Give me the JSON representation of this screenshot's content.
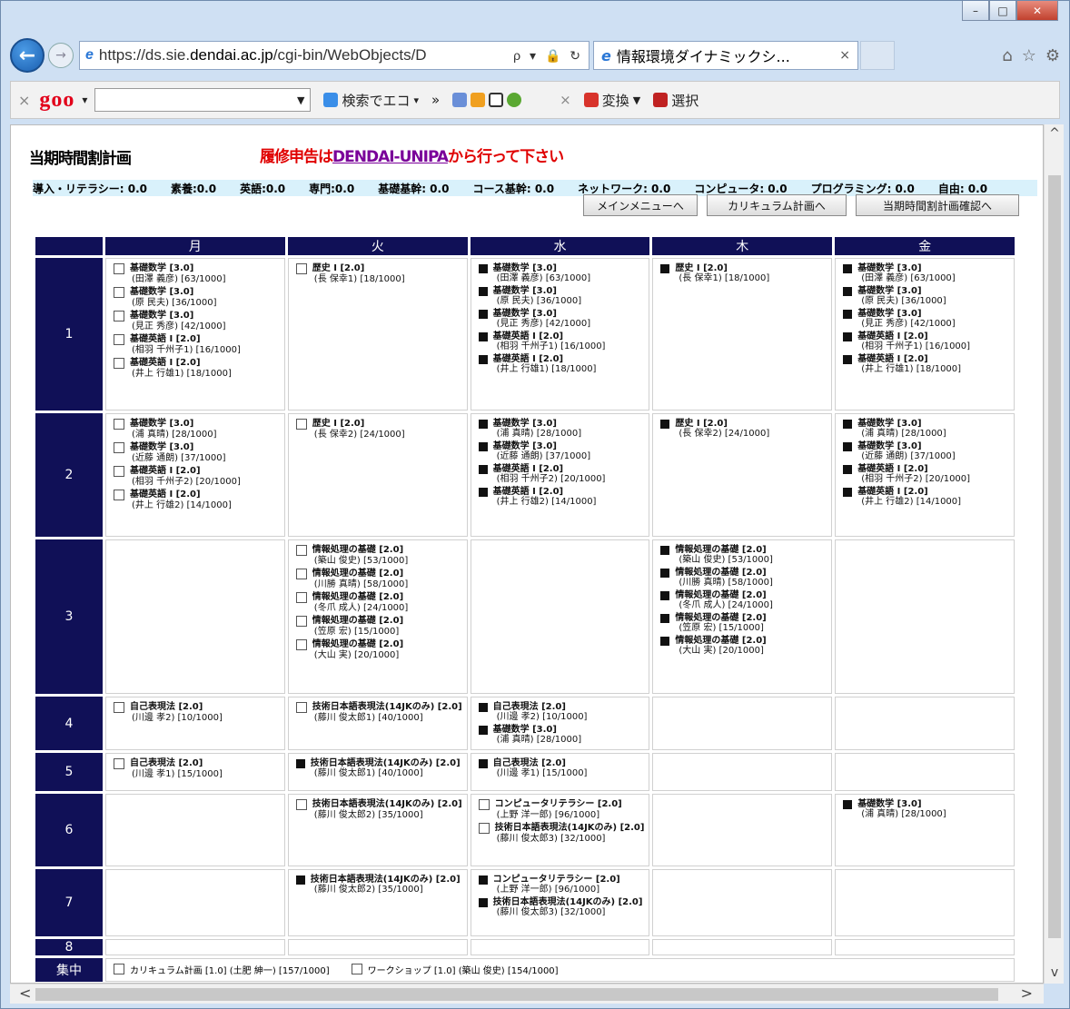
{
  "browser": {
    "url_prefix": "https://ds.sie.",
    "url_host": "dendai.ac.jp",
    "url_rest": "/cgi-bin/WebObjects/D",
    "url_tools": "ρ ▾ 🔒 ↻",
    "tab_title": "情報環境ダイナミックシ...",
    "tab_close": "×",
    "win_min": "–",
    "win_max": "□",
    "win_close": "✕",
    "back": "←",
    "forward": "→",
    "nav_icons": [
      "⌂",
      "☆",
      "⚙"
    ]
  },
  "goo_toolbar": {
    "close": "×",
    "logo": "goo",
    "dropdown": "▾",
    "search_input_value": "",
    "search_label": "検索でエコ",
    "more": "»",
    "right_close": "×",
    "convert_label": "変換",
    "select_label": "選択"
  },
  "page": {
    "title": "当期時間割計画",
    "notice_prefix": "履修申告は",
    "notice_link": "DENDAI-UNIPA",
    "notice_suffix": "から行って下さい",
    "credits": [
      "導入・リテラシー: 0.0",
      "素養:0.0",
      "英語:0.0",
      "専門:0.0",
      "基礎基幹: 0.0",
      "コース基幹: 0.0",
      "ネットワーク: 0.0",
      "コンピュータ: 0.0",
      "プログラミング: 0.0",
      "自由: 0.0"
    ],
    "buttons": {
      "main_menu": "メインメニューへ",
      "curriculum": "カリキュラム計画へ",
      "confirm": "当期時間割計画確認へ"
    }
  },
  "timetable": {
    "days": [
      "月",
      "火",
      "水",
      "木",
      "金"
    ],
    "periods": [
      {
        "label": "1",
        "cells": [
          [
            {
              "checked": false,
              "name": "基礎数学 [3.0]",
              "detail": "(田澤 義彦) [63/1000]"
            },
            {
              "checked": false,
              "name": "基礎数学 [3.0]",
              "detail": "(原 民夫) [36/1000]"
            },
            {
              "checked": false,
              "name": "基礎数学 [3.0]",
              "detail": "(見正 秀彦) [42/1000]"
            },
            {
              "checked": false,
              "name": "基礎英語 I [2.0]",
              "detail": "(相羽 千州子1) [16/1000]"
            },
            {
              "checked": false,
              "name": "基礎英語 I [2.0]",
              "detail": "(井上 行雄1) [18/1000]"
            }
          ],
          [
            {
              "checked": false,
              "name": "歴史 I [2.0]",
              "detail": "(長 保幸1) [18/1000]"
            }
          ],
          [
            {
              "checked": true,
              "name": "基礎数学 [3.0]",
              "detail": "(田澤 義彦) [63/1000]"
            },
            {
              "checked": true,
              "name": "基礎数学 [3.0]",
              "detail": "(原 民夫) [36/1000]"
            },
            {
              "checked": true,
              "name": "基礎数学 [3.0]",
              "detail": "(見正 秀彦) [42/1000]"
            },
            {
              "checked": true,
              "name": "基礎英語 I [2.0]",
              "detail": "(相羽 千州子1) [16/1000]"
            },
            {
              "checked": true,
              "name": "基礎英語 I [2.0]",
              "detail": "(井上 行雄1) [18/1000]"
            }
          ],
          [
            {
              "checked": true,
              "name": "歴史 I [2.0]",
              "detail": "(長 保幸1) [18/1000]"
            }
          ],
          [
            {
              "checked": true,
              "name": "基礎数学 [3.0]",
              "detail": "(田澤 義彦) [63/1000]"
            },
            {
              "checked": true,
              "name": "基礎数学 [3.0]",
              "detail": "(原 民夫) [36/1000]"
            },
            {
              "checked": true,
              "name": "基礎数学 [3.0]",
              "detail": "(見正 秀彦) [42/1000]"
            },
            {
              "checked": true,
              "name": "基礎英語 I [2.0]",
              "detail": "(相羽 千州子1) [16/1000]"
            },
            {
              "checked": true,
              "name": "基礎英語 I [2.0]",
              "detail": "(井上 行雄1) [18/1000]"
            }
          ]
        ]
      },
      {
        "label": "2",
        "cells": [
          [
            {
              "checked": false,
              "name": "基礎数学 [3.0]",
              "detail": "(浦 真晴) [28/1000]"
            },
            {
              "checked": false,
              "name": "基礎数学 [3.0]",
              "detail": "(近藤 通朗) [37/1000]"
            },
            {
              "checked": false,
              "name": "基礎英語 I [2.0]",
              "detail": "(相羽 千州子2) [20/1000]"
            },
            {
              "checked": false,
              "name": "基礎英語 I [2.0]",
              "detail": "(井上 行雄2) [14/1000]"
            }
          ],
          [
            {
              "checked": false,
              "name": "歴史 I [2.0]",
              "detail": "(長 保幸2) [24/1000]"
            }
          ],
          [
            {
              "checked": true,
              "name": "基礎数学 [3.0]",
              "detail": "(浦 真晴) [28/1000]"
            },
            {
              "checked": true,
              "name": "基礎数学 [3.0]",
              "detail": "(近藤 通朗) [37/1000]"
            },
            {
              "checked": true,
              "name": "基礎英語 I [2.0]",
              "detail": "(相羽 千州子2) [20/1000]"
            },
            {
              "checked": true,
              "name": "基礎英語 I [2.0]",
              "detail": "(井上 行雄2) [14/1000]"
            }
          ],
          [
            {
              "checked": true,
              "name": "歴史 I [2.0]",
              "detail": "(長 保幸2) [24/1000]"
            }
          ],
          [
            {
              "checked": true,
              "name": "基礎数学 [3.0]",
              "detail": "(浦 真晴) [28/1000]"
            },
            {
              "checked": true,
              "name": "基礎数学 [3.0]",
              "detail": "(近藤 通朗) [37/1000]"
            },
            {
              "checked": true,
              "name": "基礎英語 I [2.0]",
              "detail": "(相羽 千州子2) [20/1000]"
            },
            {
              "checked": true,
              "name": "基礎英語 I [2.0]",
              "detail": "(井上 行雄2) [14/1000]"
            }
          ]
        ]
      },
      {
        "label": "3",
        "cells": [
          [],
          [
            {
              "checked": false,
              "name": "情報処理の基礎 [2.0]",
              "detail": "(築山 俊史) [53/1000]"
            },
            {
              "checked": false,
              "name": "情報処理の基礎 [2.0]",
              "detail": "(川勝 真晴) [58/1000]"
            },
            {
              "checked": false,
              "name": "情報処理の基礎 [2.0]",
              "detail": "(冬爪 成人) [24/1000]"
            },
            {
              "checked": false,
              "name": "情報処理の基礎 [2.0]",
              "detail": "(笠原 宏) [15/1000]"
            },
            {
              "checked": false,
              "name": "情報処理の基礎 [2.0]",
              "detail": "(大山 実) [20/1000]"
            }
          ],
          [],
          [
            {
              "checked": true,
              "name": "情報処理の基礎 [2.0]",
              "detail": "(築山 俊史) [53/1000]"
            },
            {
              "checked": true,
              "name": "情報処理の基礎 [2.0]",
              "detail": "(川勝 真晴) [58/1000]"
            },
            {
              "checked": true,
              "name": "情報処理の基礎 [2.0]",
              "detail": "(冬爪 成人) [24/1000]"
            },
            {
              "checked": true,
              "name": "情報処理の基礎 [2.0]",
              "detail": "(笠原 宏) [15/1000]"
            },
            {
              "checked": true,
              "name": "情報処理の基礎 [2.0]",
              "detail": "(大山 実) [20/1000]"
            }
          ],
          []
        ]
      },
      {
        "label": "4",
        "cells": [
          [
            {
              "checked": false,
              "name": "自己表現法 [2.0]",
              "detail": "(川邊 孝2) [10/1000]"
            }
          ],
          [
            {
              "checked": false,
              "name": "技術日本語表現法(14JKのみ) [2.0]",
              "detail": "(藤川 俊太郎1) [40/1000]"
            }
          ],
          [
            {
              "checked": true,
              "name": "自己表現法 [2.0]",
              "detail": "(川邊 孝2) [10/1000]"
            },
            {
              "checked": true,
              "name": "基礎数学 [3.0]",
              "detail": "(浦 真晴) [28/1000]"
            }
          ],
          [],
          []
        ]
      },
      {
        "label": "5",
        "cells": [
          [
            {
              "checked": false,
              "name": "自己表現法 [2.0]",
              "detail": "(川邊 孝1) [15/1000]"
            }
          ],
          [
            {
              "checked": true,
              "name": "技術日本語表現法(14JKのみ) [2.0]",
              "detail": "(藤川 俊太郎1) [40/1000]"
            }
          ],
          [
            {
              "checked": true,
              "name": "自己表現法 [2.0]",
              "detail": "(川邊 孝1) [15/1000]"
            }
          ],
          [],
          []
        ]
      },
      {
        "label": "6",
        "cells": [
          [],
          [
            {
              "checked": false,
              "name": "技術日本語表現法(14JKのみ) [2.0]",
              "detail": "(藤川 俊太郎2) [35/1000]"
            }
          ],
          [
            {
              "checked": false,
              "name": "コンピュータリテラシー [2.0]",
              "detail": "(上野 洋一郎) [96/1000]"
            },
            {
              "checked": false,
              "name": "技術日本語表現法(14JKのみ) [2.0]",
              "detail": "(藤川 俊太郎3) [32/1000]"
            }
          ],
          [],
          [
            {
              "checked": true,
              "name": "基礎数学 [3.0]",
              "detail": "(浦 真晴) [28/1000]"
            }
          ]
        ]
      },
      {
        "label": "7",
        "cells": [
          [],
          [
            {
              "checked": true,
              "name": "技術日本語表現法(14JKのみ) [2.0]",
              "detail": "(藤川 俊太郎2) [35/1000]"
            }
          ],
          [
            {
              "checked": true,
              "name": "コンピュータリテラシー [2.0]",
              "detail": "(上野 洋一郎) [96/1000]"
            },
            {
              "checked": true,
              "name": "技術日本語表現法(14JKのみ) [2.0]",
              "detail": "(藤川 俊太郎3) [32/1000]"
            }
          ],
          [],
          []
        ]
      },
      {
        "label": "8",
        "cells": [
          [],
          [],
          [],
          [],
          []
        ]
      }
    ],
    "intensive": {
      "label": "集中",
      "entries": [
        {
          "checked": false,
          "text": "カリキュラム計画 [1.0] (土肥 紳一) [157/1000]"
        },
        {
          "checked": false,
          "text": "ワークショップ [1.0] (築山 俊史) [154/1000]"
        }
      ]
    }
  },
  "scroll": {
    "up": "^",
    "down": "v",
    "left": "<",
    "right": ">"
  },
  "colors": {
    "header_bg": "#101057",
    "notice_red": "#e00000",
    "credit_bar": "#d9f1fb"
  }
}
